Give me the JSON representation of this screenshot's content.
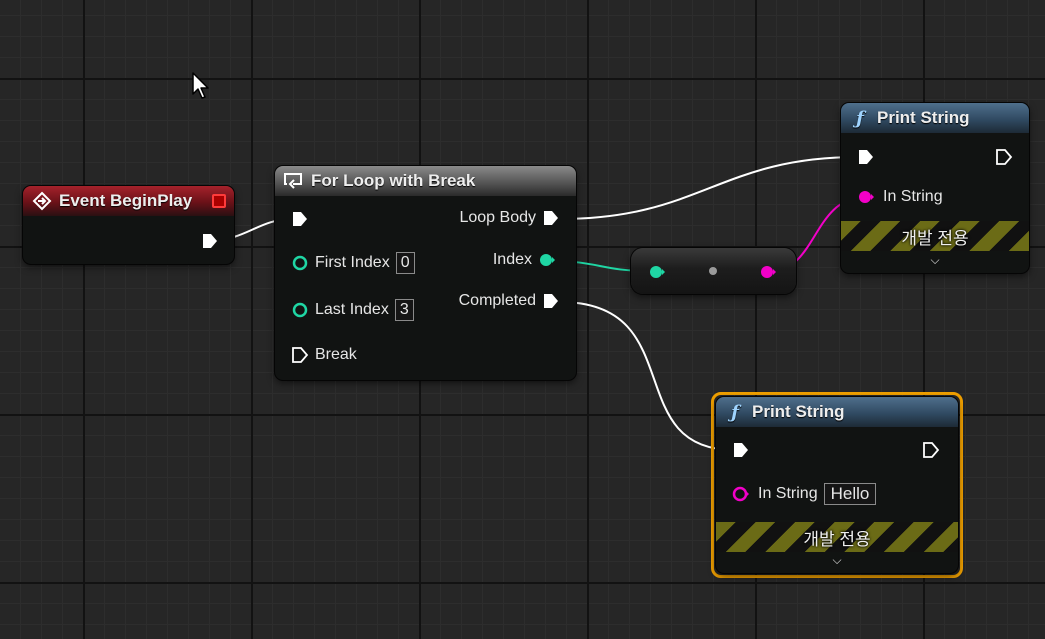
{
  "event_node": {
    "title": "Event BeginPlay",
    "header_color": "#a5222b"
  },
  "loop_node": {
    "title": "For Loop with Break",
    "inputs": {
      "first_index_label": "First Index",
      "first_index_value": "0",
      "last_index_label": "Last Index",
      "last_index_value": "3",
      "break_label": "Break"
    },
    "outputs": {
      "loop_body_label": "Loop Body",
      "index_label": "Index",
      "completed_label": "Completed"
    }
  },
  "print_node_top": {
    "title": "Print String",
    "in_string_label": "In String",
    "dev_only_label": "개발 전용"
  },
  "print_node_bottom": {
    "title": "Print String",
    "in_string_label": "In String",
    "in_string_value": "Hello",
    "dev_only_label": "개발 전용"
  },
  "colors": {
    "exec": "#ffffff",
    "integer_pin": "#1fd6a4",
    "string_pin": "#f200c8",
    "selection": "#f0a000",
    "event_header": "#a5222b",
    "function_header": "#304a62"
  },
  "icons": {
    "event": "diamond-arrow-icon",
    "macro": "loop-icon",
    "function": "function-f-icon",
    "cursor": "mouse-pointer-icon"
  }
}
